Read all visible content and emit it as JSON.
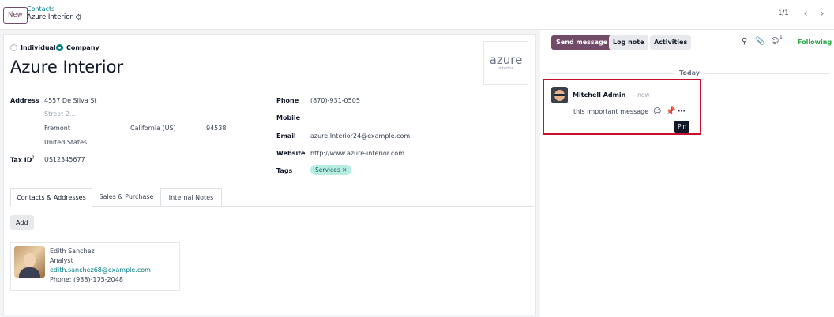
{
  "breadcrumb": {
    "new_label": "New",
    "parent": "Contacts",
    "current": "Azure Interior"
  },
  "pager": {
    "value": "1/1",
    "prev_icon": "chevron-left-icon",
    "next_icon": "chevron-right-icon"
  },
  "form": {
    "type_options": [
      "Individual",
      "Company"
    ],
    "type_selected": "Company",
    "name": "Azure Interior",
    "logo": {
      "text": "azure",
      "subtext": "interior"
    },
    "address_label": "Address",
    "street": "4557 De Silva St",
    "street2_placeholder": "Street 2...",
    "city": "Fremont",
    "state": "California (US)",
    "zip": "94538",
    "country": "United States",
    "tax_id_label": "Tax ID",
    "tax_id_help": "?",
    "tax_id": "US12345677",
    "phone_label": "Phone",
    "phone": "(870)-931-0505",
    "mobile_label": "Mobile",
    "email_label": "Email",
    "email": "azure.Interior24@example.com",
    "website_label": "Website",
    "website": "http://www.azure-interior.com",
    "tags_label": "Tags",
    "tag": "Services"
  },
  "tabs": [
    {
      "label": "Contacts & Addresses",
      "active": true
    },
    {
      "label": "Sales & Purchase",
      "active": false
    },
    {
      "label": "Internal Notes",
      "active": false
    }
  ],
  "contacts": {
    "add_label": "Add",
    "cards": [
      {
        "name": "Edith Sanchez",
        "role": "Analyst",
        "email": "edith.sanchez68@example.com",
        "phone": "Phone: (938)-175-2048"
      }
    ]
  },
  "chatter": {
    "send_message": "Send message",
    "log_note": "Log note",
    "activities": "Activities",
    "followers_count": "1",
    "following": "Following",
    "date_divider": "Today",
    "message": {
      "author": "Mitchell Admin",
      "time": "- now",
      "body": "this important message"
    },
    "tooltip": "Pin"
  },
  "colors": {
    "brand": "#714b67",
    "accent": "#017e84",
    "following": "#28a745",
    "highlight": "#c8102e"
  }
}
